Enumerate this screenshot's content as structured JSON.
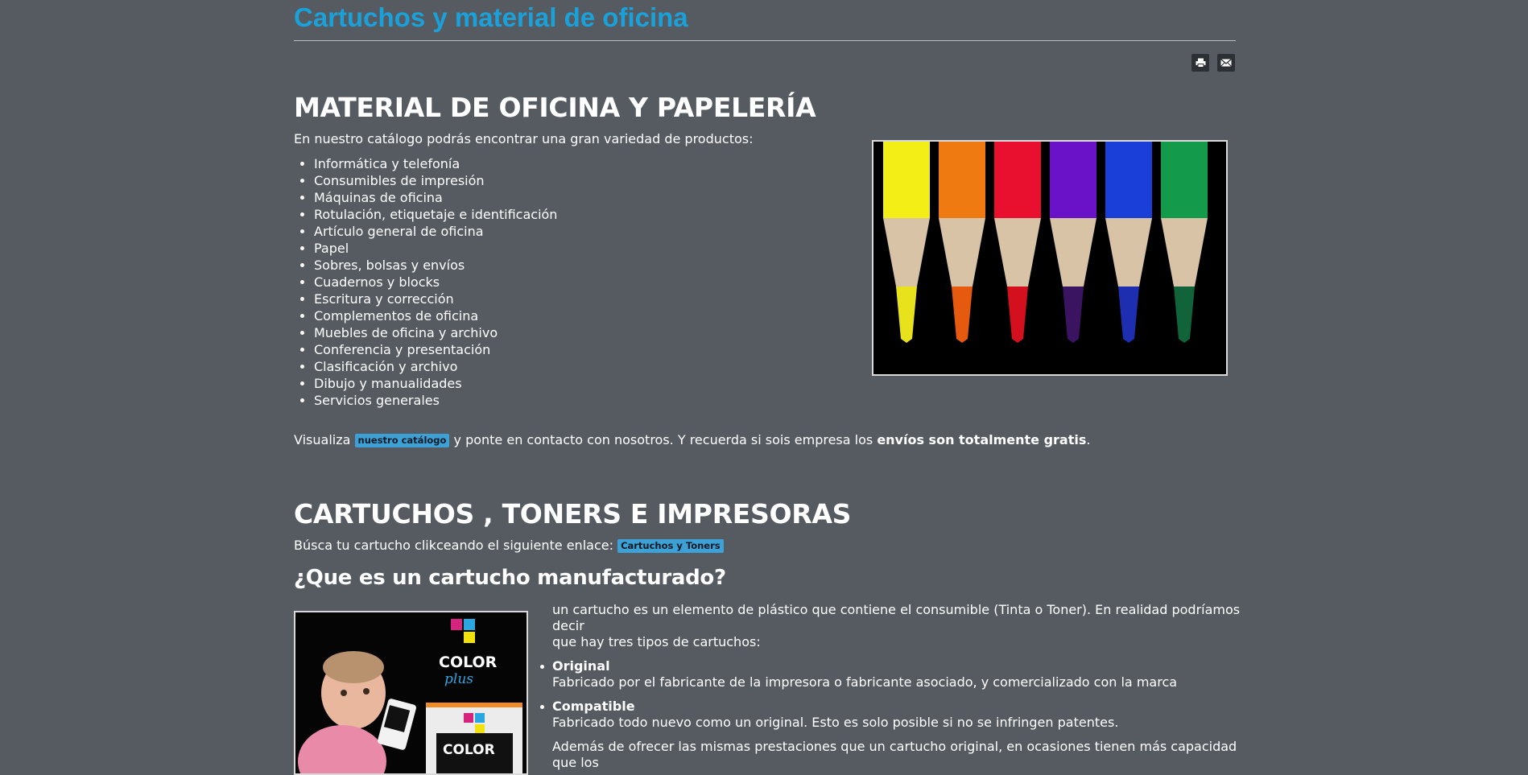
{
  "header": {
    "title": "Cartuchos y material de oficina"
  },
  "toolbar": {
    "print_icon": "print-icon",
    "email_icon": "email-icon"
  },
  "section_material": {
    "heading": "MATERIAL DE OFICINA Y PAPELERÍA",
    "intro": "En nuestro catálogo podrás encontrar una gran variedad de productos:",
    "items": [
      "Informática y telefonía",
      "Consumibles de impresión",
      "Máquinas de oficina",
      "Rotulación, etiquetaje e identificación",
      "Artículo general de oficina",
      "Papel",
      "Sobres, bolsas y envíos",
      "Cuadernos y blocks",
      "Escritura y corrección",
      "Complementos de oficina",
      "Muebles de oficina y archivo",
      "Conferencia y presentación",
      "Clasificación y archivo",
      "Dibujo y manualidades",
      "Servicios generales"
    ],
    "cta_prefix": "Visualiza",
    "cta_link": "nuestro catálogo",
    "cta_middle": "y ponte en contacto con nosotros. Y recuerda si sois empresa los",
    "cta_bold": "envíos son totalmente gratis",
    "cta_end": "."
  },
  "section_cartuchos": {
    "heading": "CARTUCHOS , TONERS E IMPRESORAS",
    "search_prefix": "Búsca tu cartucho clikceando el siguiente enlace:",
    "search_link": "Cartuchos y Toners",
    "subheading": "¿Que es un cartucho manufacturado?",
    "intro_line1": "un cartucho es un elemento de plástico que contiene el consumible (Tinta o Toner). En realidad podríamos decir",
    "intro_line2": "que hay tres tipos de cartuchos:",
    "types": [
      {
        "name": "Original",
        "desc": "Fabricado por el fabricante de la impresora o fabricante asociado, y comercializado con la marca"
      },
      {
        "name": "Compatible",
        "desc": "Fabricado todo nuevo como un original. Esto es solo posible si no se infringen patentes."
      }
    ],
    "extra": "Además de ofrecer las mismas prestaciones que un cartucho original, en ocasiones tienen más capacidad que los",
    "brand_line1": "COLOR",
    "brand_line2": "plus",
    "box_text": "COLOR"
  },
  "colors": {
    "background": "#565b62",
    "title": "#1aa1da",
    "pill": "#3ea1d6"
  }
}
